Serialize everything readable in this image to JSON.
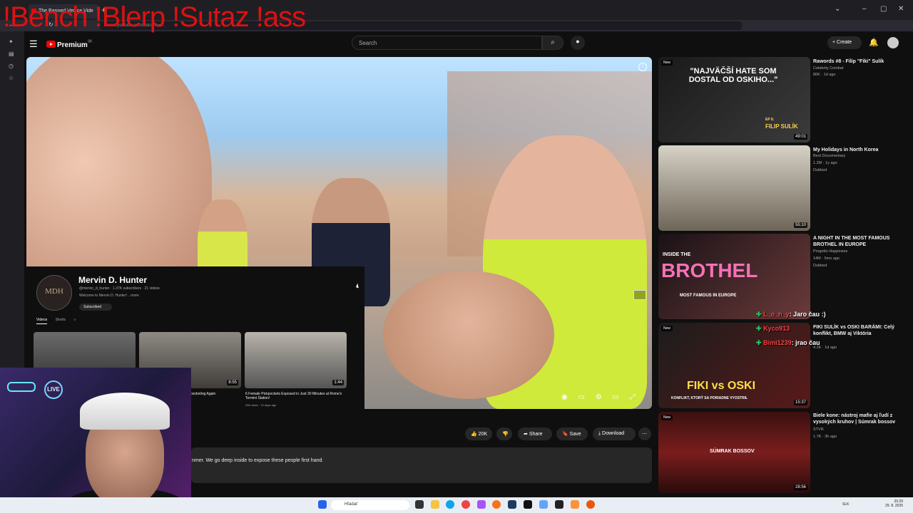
{
  "overlay": {
    "text": "!Bench !Blerp !Sutaz !ass"
  },
  "browser": {
    "tab_title": "The Banned Venice Vide",
    "new_tab": "+",
    "url": "www.youtube.com/watch?v=..."
  },
  "header": {
    "logo_text": "Premium",
    "logo_region": "SK",
    "search_placeholder": "Search",
    "create_label": "Create"
  },
  "channel_card": {
    "avatar_text": "MDH",
    "name": "Mervin D. Hunter",
    "meta": "@mervin_d_hunter · 1.37K subscribers · 21 videos",
    "desc": "Welcome to Mervin D. Hunter! ...more",
    "subscribed": "Subscribed",
    "tabs": [
      "Videos",
      "Shorts"
    ],
    "videos": [
      {
        "caption": "",
        "sub": ""
      },
      {
        "caption": "pocketing Again",
        "sub": ""
      },
      {
        "caption": "6 Female Pickpockets Exposed in Just 30 Minutes at Rome's Termini Station!",
        "sub": "296 views · 12 days ago"
      }
    ],
    "durations": [
      "8:55",
      "1:44"
    ]
  },
  "actions": {
    "likes": "20K",
    "share": "Share",
    "save": "Save",
    "download": "Download"
  },
  "description": {
    "text": "nmer. We go deep inside to expose these people first hand."
  },
  "recommended": [
    {
      "title": "Rawords #8 - Filip \"Fiki\" Sulík",
      "channel": "Celebrity Combat",
      "stats": "80K · 1d ago",
      "badge": "",
      "duration": "49:01",
      "is_new": "New",
      "thumb_text": "\"NAJVÄČŠÍ HATE SOM DOSTAL OD OSKIHO...\"",
      "thumb_sub": "FILIP SULÍK",
      "thumb_tag": "EP 8."
    },
    {
      "title": "My Holidays in North Korea",
      "channel": "Best Documentary",
      "stats": "1.2M · 1y ago",
      "badge": "Dubbed",
      "duration": "55:10",
      "is_new": "",
      "thumb_text": "",
      "thumb_sub": "",
      "thumb_tag": ""
    },
    {
      "title": "A NIGHT IN THE MOST FAMOUS BROTHEL IN EUROPE",
      "channel": "Progetto Happiness",
      "stats": "14M · 5mo ago",
      "badge": "Dubbed",
      "duration": "",
      "is_new": "",
      "thumb_text": "BROTHEL",
      "thumb_sub": "MOST FAMOUS IN EUROPE",
      "thumb_tag": "INSIDE THE"
    },
    {
      "title": "FIKI SULÍK vs OSKI BARÁMI: Celý konflikt, BMW aj Viktória",
      "channel": "",
      "stats": "4.2K · 1d ago",
      "badge": "",
      "duration": "15:37",
      "is_new": "New",
      "thumb_text": "FIKI vs OSKI",
      "thumb_sub": "KONFLIKT, KTORÝ SA PORIADNE VYOSTRIL",
      "thumb_tag": ""
    },
    {
      "title": "Biele kone: nástroj mafie aj ľudí z vysokých kruhov | Súmrak bossov",
      "channel": "STVR",
      "stats": "1.7K · 3h ago",
      "badge": "",
      "duration": "28:56",
      "is_new": "New",
      "thumb_text": "SÚMRAK BOSSOV",
      "thumb_sub": "",
      "thumb_tag": ""
    }
  ],
  "chat": [
    {
      "user": "L_o_h_y",
      "message": ": Jaro čau :)"
    },
    {
      "user": "Kyco913",
      "message": ""
    },
    {
      "user": "Bimi1239",
      "message": ": jrao čau"
    }
  ],
  "taskbar": {
    "search": "Hľadať",
    "lang": "SLK",
    "time": "20:29",
    "date": "29. 8. 2025"
  },
  "colors": {
    "accent_red": "#ff0000",
    "chat_green": "#22c55e",
    "chat_red": "#ef4444"
  },
  "icons": [
    "menu-icon",
    "search-icon",
    "mic-icon",
    "bell-icon",
    "like-icon",
    "dislike-icon",
    "share-icon",
    "save-icon",
    "download-icon",
    "more-icon",
    "windows-icon"
  ]
}
